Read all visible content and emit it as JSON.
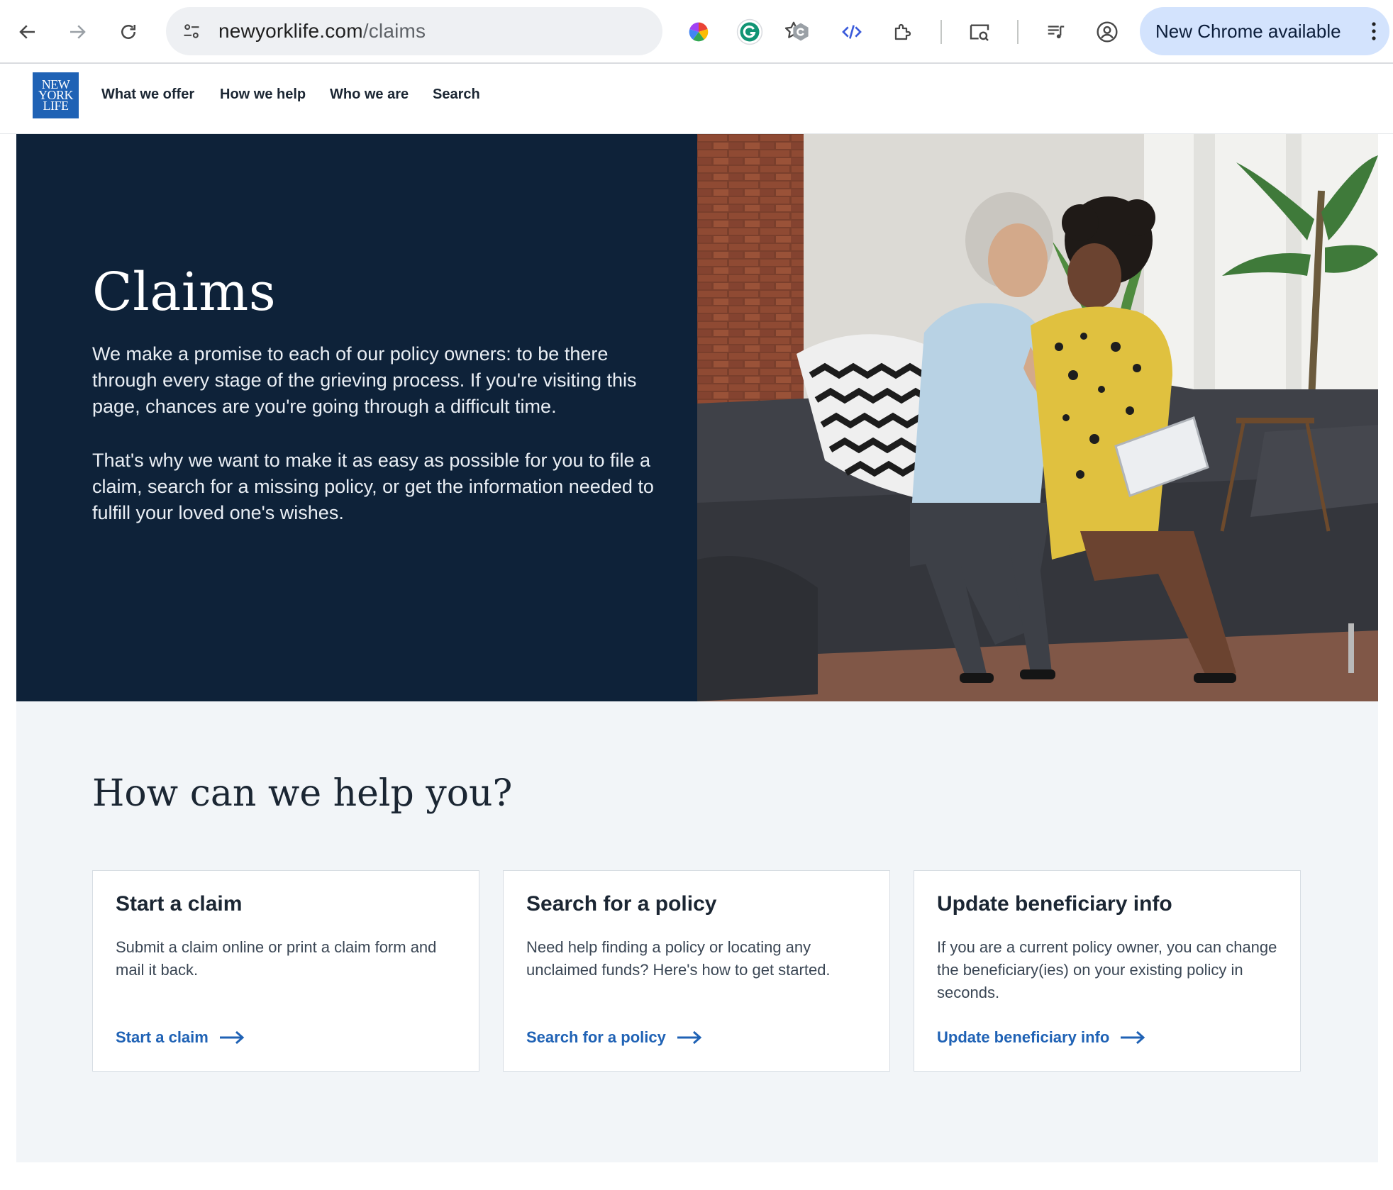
{
  "browser": {
    "url_host": "newyorklife.com",
    "url_path": "/claims",
    "update_label": "New Chrome available"
  },
  "site": {
    "logo_lines": [
      "NEW",
      "YORK",
      "LIFE"
    ],
    "nav": [
      "What we offer",
      "How we help",
      "Who we are",
      "Search"
    ]
  },
  "hero": {
    "title": "Claims",
    "paragraph1": "We make a promise to each of our policy owners: to be there through every stage of the grieving process. If you're visiting this page, chances are you're going through a difficult time.",
    "paragraph2": "That's why we want to make it as easy as possible for you to file a claim, search for a missing policy, or get the information needed to fulfill your loved one's wishes."
  },
  "help": {
    "title": "How can we help you?",
    "cards": [
      {
        "title": "Start a claim",
        "body": "Submit a claim online or print a claim form and mail it back.",
        "link": "Start a claim"
      },
      {
        "title": "Search for a policy",
        "body": "Need help finding a policy or locating any unclaimed funds? Here's how to get started.",
        "link": "Search for a policy"
      },
      {
        "title": "Update beneficiary info",
        "body": "If you are a current policy owner, you can change the beneficiary(ies) on your existing policy in seconds.",
        "link": "Update beneficiary info"
      }
    ]
  },
  "colors": {
    "navy": "#0e2239",
    "brand_blue": "#1f62b5",
    "section_bg": "#f2f5f8"
  }
}
